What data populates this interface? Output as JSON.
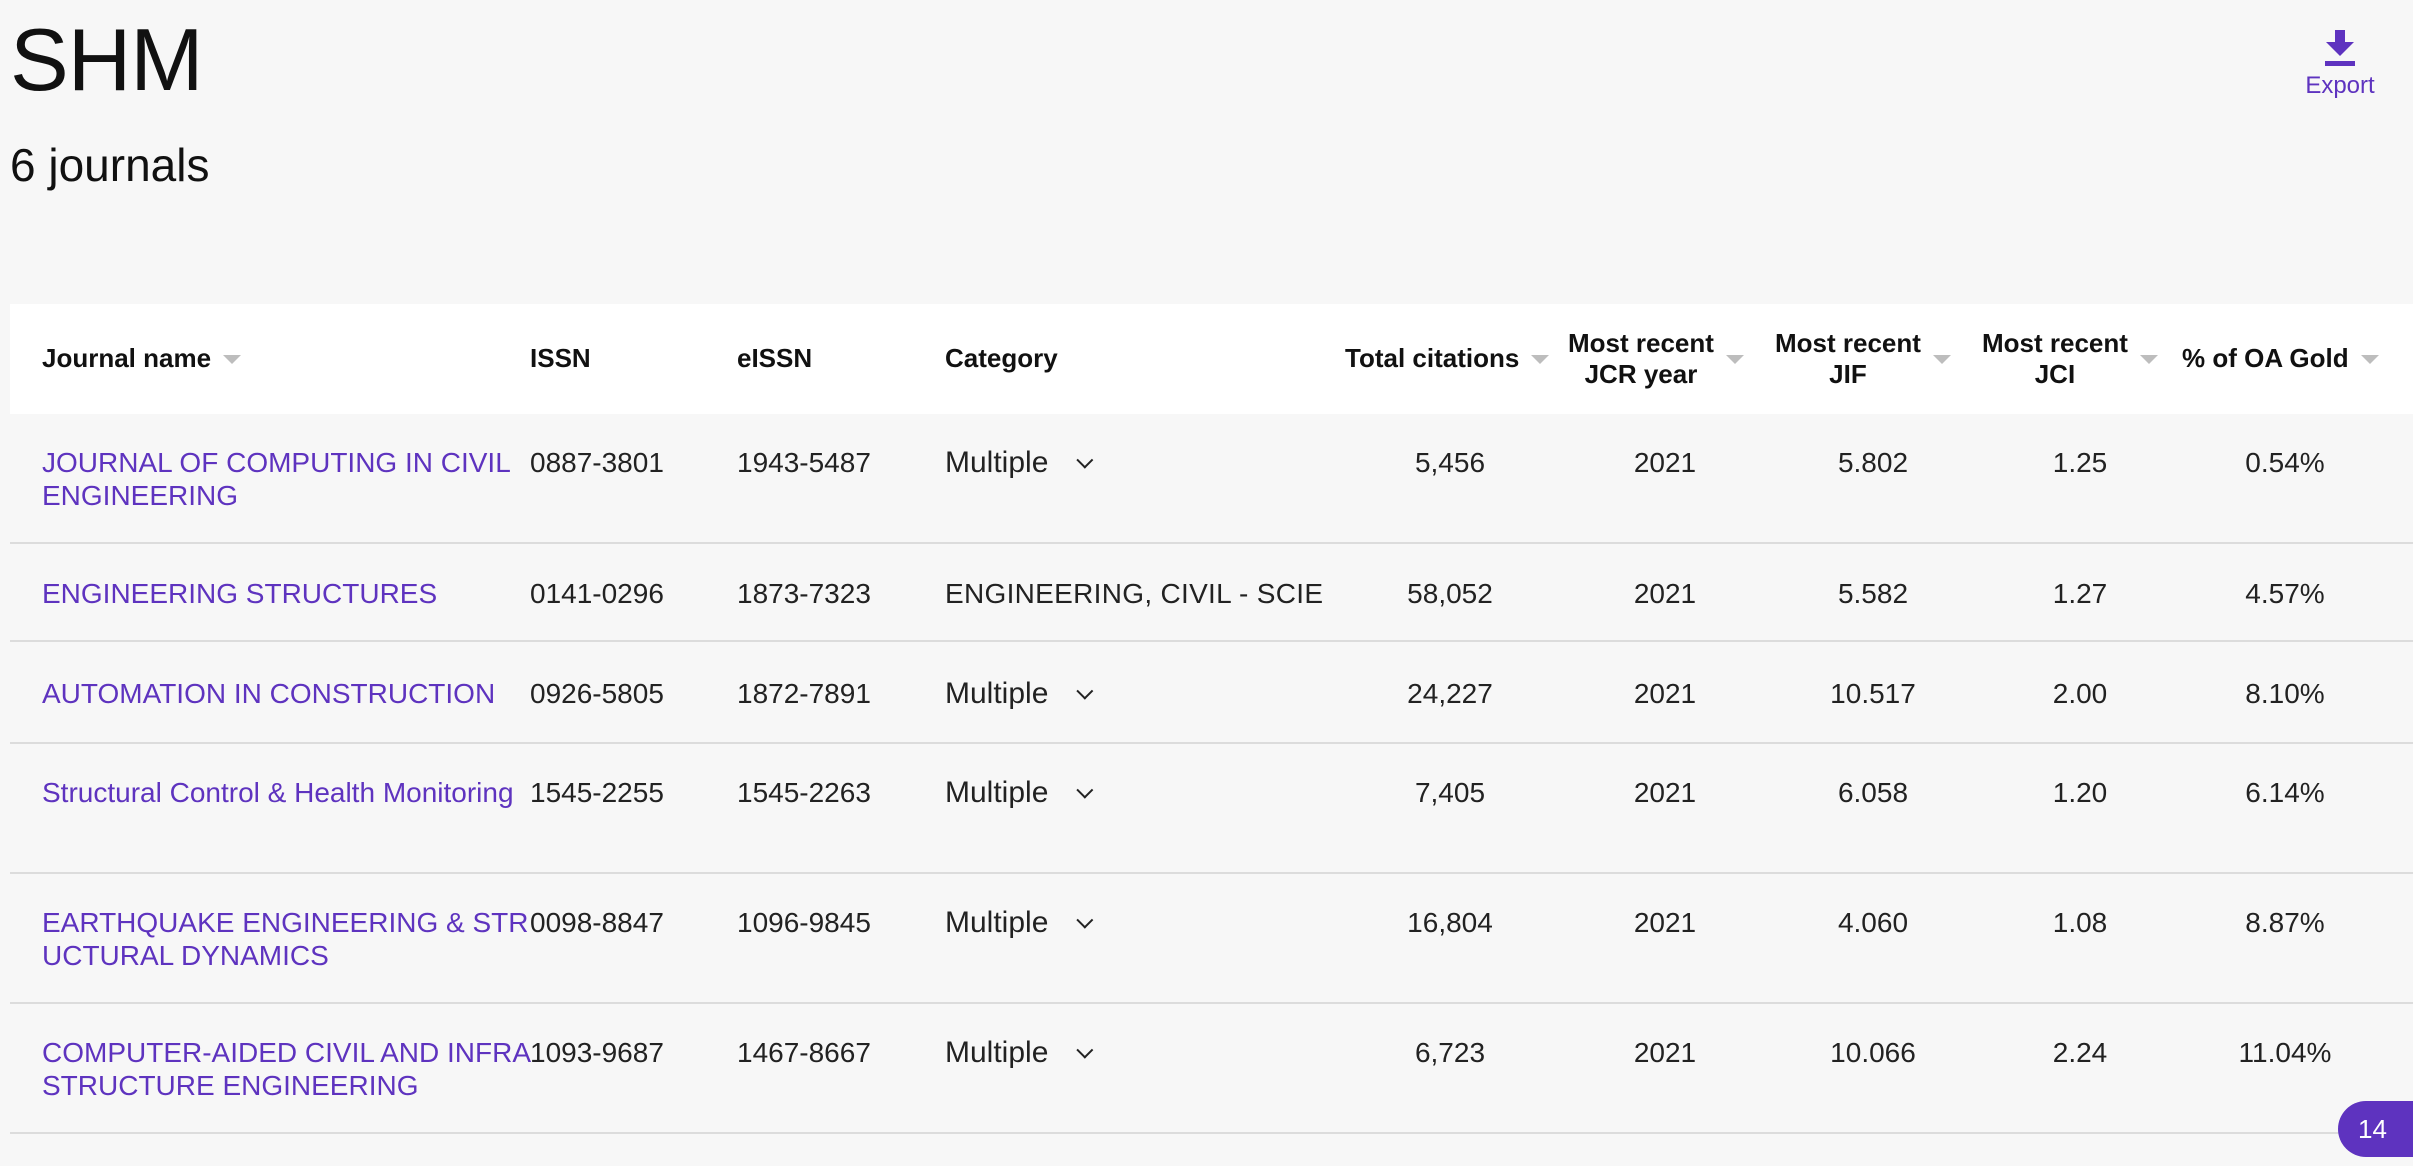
{
  "header": {
    "title": "SHM",
    "count": "6 journals",
    "export_label": "Export"
  },
  "table": {
    "columns": {
      "journal": "Journal name",
      "issn": "ISSN",
      "eissn": "eISSN",
      "category": "Category",
      "citations": "Total citations",
      "jcr_year_1": "Most recent",
      "jcr_year_2": "JCR year",
      "jif_1": "Most recent",
      "jif_2": "JIF",
      "jci_1": "Most recent",
      "jci_2": "JCI",
      "oa": "% of OA Gold"
    },
    "rows": [
      {
        "name": "JOURNAL OF COMPUTING IN CIVIL ENGINEERING",
        "issn": "0887-3801",
        "eissn": "1943-5487",
        "category": "Multiple",
        "multi": true,
        "citations": "5,456",
        "year": "2021",
        "jif": "5.802",
        "jci": "1.25",
        "oa": "0.54%"
      },
      {
        "name": "ENGINEERING STRUCTURES",
        "issn": "0141-0296",
        "eissn": "1873-7323",
        "category": "ENGINEERING, CIVIL - SCIE",
        "multi": false,
        "citations": "58,052",
        "year": "2021",
        "jif": "5.582",
        "jci": "1.27",
        "oa": "4.57%"
      },
      {
        "name": "AUTOMATION IN CONSTRUCTION",
        "issn": "0926-5805",
        "eissn": "1872-7891",
        "category": "Multiple",
        "multi": true,
        "citations": "24,227",
        "year": "2021",
        "jif": "10.517",
        "jci": "2.00",
        "oa": "8.10%"
      },
      {
        "name": "Structural Control & Health Monitoring",
        "issn": "1545-2255",
        "eissn": "1545-2263",
        "category": "Multiple",
        "multi": true,
        "citations": "7,405",
        "year": "2021",
        "jif": "6.058",
        "jci": "1.20",
        "oa": "6.14%"
      },
      {
        "name": "EARTHQUAKE ENGINEERING & STRUCTURAL DYNAMICS",
        "issn": "0098-8847",
        "eissn": "1096-9845",
        "category": "Multiple",
        "multi": true,
        "citations": "16,804",
        "year": "2021",
        "jif": "4.060",
        "jci": "1.08",
        "oa": "8.87%"
      },
      {
        "name": "COMPUTER-AIDED CIVIL AND INFRASTRUCTURE ENGINEERING",
        "issn": "1093-9687",
        "eissn": "1467-8667",
        "category": "Multiple",
        "multi": true,
        "citations": "6,723",
        "year": "2021",
        "jif": "10.066",
        "jci": "2.24",
        "oa": "11.04%"
      }
    ]
  },
  "badge": {
    "count": "14"
  },
  "colors": {
    "accent": "#5e33bf",
    "divider": "#dcdcdc",
    "header_bg": "#ffffff"
  }
}
